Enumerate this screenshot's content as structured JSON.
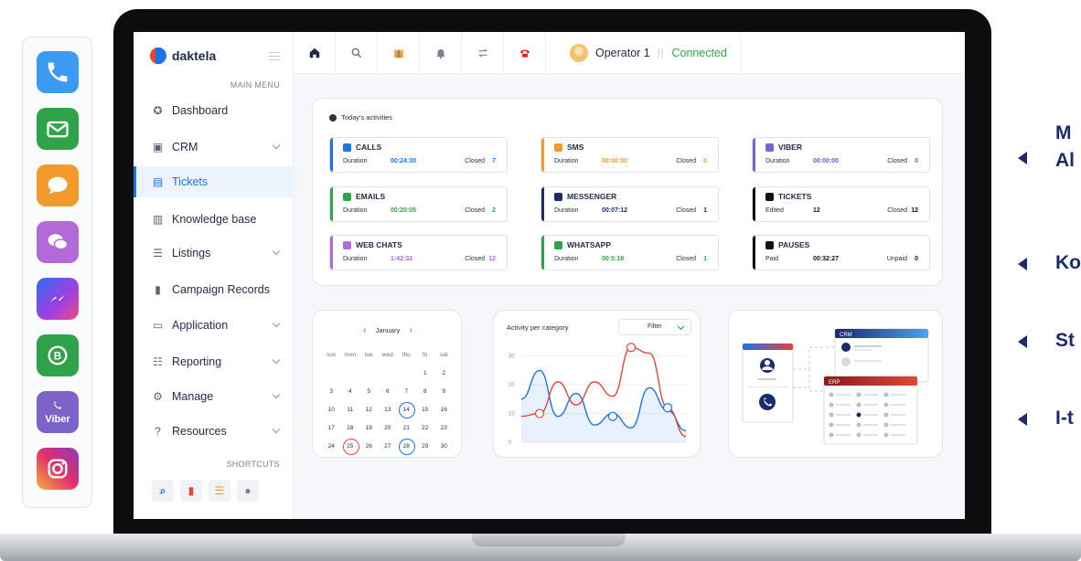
{
  "dock": {
    "apps": [
      {
        "name": "phone-icon",
        "color": "#3b9af3"
      },
      {
        "name": "email-icon",
        "color": "#2fa24a"
      },
      {
        "name": "sms-icon",
        "color": "#f39a2c"
      },
      {
        "name": "webchat-icon",
        "color": "#b36ad9"
      },
      {
        "name": "messenger-icon",
        "color": "#6a4bf0"
      },
      {
        "name": "whatsapp-icon",
        "color": "#2fa24a"
      },
      {
        "name": "viber-icon",
        "color": "#7b63c9",
        "label": "Viber"
      },
      {
        "name": "instagram-icon",
        "color": "#e1306c"
      }
    ]
  },
  "brand": {
    "name": "daktela"
  },
  "sidebar": {
    "main_menu_label": "MAIN MENU",
    "items": [
      {
        "label": "Dashboard",
        "icon": "dashboard-icon"
      },
      {
        "label": "CRM",
        "icon": "crm-icon"
      },
      {
        "label": "Tickets",
        "icon": "ticket-icon"
      },
      {
        "label": "Knowledge base",
        "icon": "book-icon"
      },
      {
        "label": "Listings",
        "icon": "list-icon"
      },
      {
        "label": "Campaign Records",
        "icon": "clipboard-icon"
      },
      {
        "label": "Application",
        "icon": "monitor-icon"
      },
      {
        "label": "Reporting",
        "icon": "report-icon"
      },
      {
        "label": "Manage",
        "icon": "gear-icon"
      },
      {
        "label": "Resources",
        "icon": "help-icon"
      }
    ],
    "shortcuts_label": "SHORTCUTS"
  },
  "topbar": {
    "operator": "Operator 1",
    "separator": "||",
    "status": "Connected"
  },
  "activities": {
    "title": "Today's activities",
    "cards": [
      {
        "title": "CALLS",
        "color": "#1a73e8",
        "lab1": "Duration",
        "val1": "00:24:30",
        "val1_color": "#1a73e8",
        "lab2": "Closed",
        "val2": "7",
        "val2_color": "#1a73e8"
      },
      {
        "title": "SMS",
        "color": "#f39a2c",
        "lab1": "Duration",
        "val1": "00:00:00",
        "val1_color": "#f39a2c",
        "lab2": "Closed",
        "val2": "0",
        "val2_color": "#f39a2c"
      },
      {
        "title": "VIBER",
        "color": "#7b63c9",
        "lab1": "Duration",
        "val1": "00:00:00",
        "val1_color": "#5b5fe0",
        "lab2": "Closed",
        "val2": "0",
        "val2_color": "#5b5fe0"
      },
      {
        "title": "EMAILS",
        "color": "#2fa24a",
        "lab1": "Duration",
        "val1": "00:20:05",
        "val1_color": "#2fa24a",
        "lab2": "Closed",
        "val2": "2",
        "val2_color": "#2fa24a"
      },
      {
        "title": "MESSENGER",
        "color": "#1c2a6e",
        "lab1": "Duration",
        "val1": "00:07:12",
        "val1_color": "#1c2a6e",
        "lab2": "Closed",
        "val2": "1",
        "val2_color": "#1c2a6e"
      },
      {
        "title": "TICKETS",
        "color": "#111111",
        "lab1": "Edited",
        "val1": "12",
        "val1_color": "#111111",
        "lab2": "Closed",
        "val2": "12",
        "val2_color": "#111111"
      },
      {
        "title": "WEB CHATS",
        "color": "#b36ad9",
        "lab1": "Duration",
        "val1": "1:42:32",
        "val1_color": "#b36ad9",
        "lab2": "Closed",
        "val2": "12",
        "val2_color": "#b36ad9"
      },
      {
        "title": "WHATSAPP",
        "color": "#2fa24a",
        "lab1": "Duration",
        "val1": "00:5:18",
        "val1_color": "#2fa24a",
        "lab2": "Closed",
        "val2": "1",
        "val2_color": "#2fa24a"
      },
      {
        "title": "PAUSES",
        "color": "#111111",
        "lab1": "Paid",
        "val1": "00:32:27",
        "val1_color": "#111111",
        "lab2": "Unpaid",
        "val2": "0",
        "val2_color": "#111111"
      }
    ]
  },
  "calendar": {
    "month": "January",
    "days_of_week": [
      "sun",
      "mon",
      "tue",
      "wed",
      "thu",
      "fri",
      "sat"
    ],
    "weeks": [
      [
        "",
        "",
        "",
        "",
        "",
        "1",
        "2"
      ],
      [
        "3",
        "4",
        "5",
        "6",
        "7",
        "8",
        "9"
      ],
      [
        "10",
        "11",
        "12",
        "13",
        "14",
        "15",
        "16"
      ],
      [
        "17",
        "18",
        "19",
        "20",
        "21",
        "22",
        "23"
      ],
      [
        "24",
        "25",
        "26",
        "27",
        "28",
        "29",
        "30"
      ]
    ],
    "highlighted_blue": [
      "14",
      "28"
    ],
    "highlighted_red": [
      "25"
    ]
  },
  "chart_data": {
    "type": "line",
    "title": "Activity per category",
    "filter_label": "Filter",
    "ylim": [
      0,
      35
    ],
    "y_ticks": [
      "0",
      "10",
      "20",
      "30"
    ],
    "series": [
      {
        "color": "#1a73e8",
        "values": [
          15,
          25,
          9,
          17,
          6,
          10,
          5,
          19,
          11,
          4
        ]
      },
      {
        "color": "#e2453a",
        "values": [
          9,
          10,
          21,
          13,
          21,
          16,
          33,
          31,
          12,
          2
        ]
      }
    ],
    "markers": [
      {
        "series": 1,
        "index": 1,
        "value": 10
      },
      {
        "series": 0,
        "index": 5,
        "value": 9
      },
      {
        "series": 1,
        "index": 6,
        "value": 33
      },
      {
        "series": 0,
        "index": 8,
        "value": 12
      }
    ]
  },
  "integration": {
    "crm_label": "CRM",
    "erp_label": "ERP"
  },
  "features": [
    {
      "text": "M"
    },
    {
      "text": "Al"
    },
    {
      "text": "Ko"
    },
    {
      "text": "St"
    },
    {
      "text": "I-t"
    }
  ]
}
